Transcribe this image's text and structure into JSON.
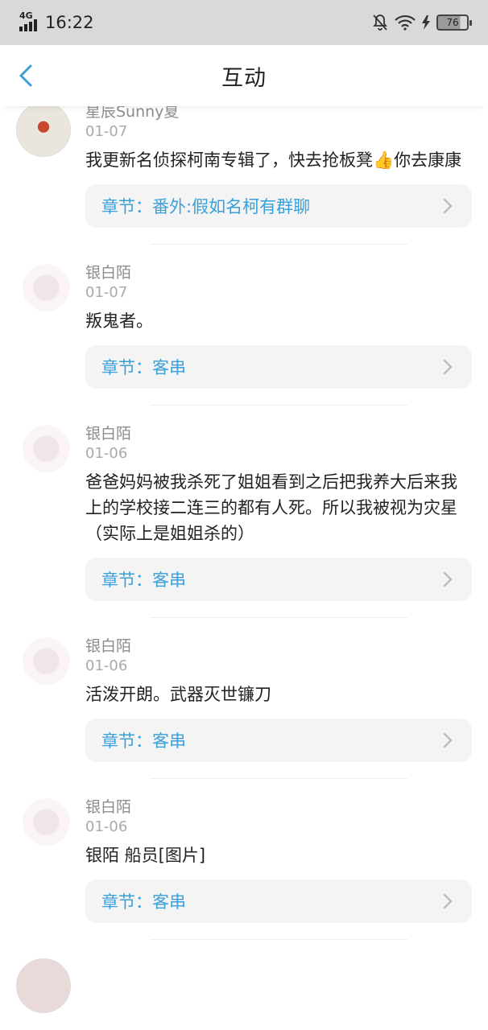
{
  "status": {
    "time": "16:22",
    "network": "4G",
    "battery": "76"
  },
  "header": {
    "title": "互动"
  },
  "items": [
    {
      "user": "星辰Sunny夏",
      "date": "01-07",
      "text": "我更新名侦探柯南专辑了，快去抢板凳👍你去康康",
      "chapter": "章节：番外:假如名柯有群聊"
    },
    {
      "user": "银白陌",
      "date": "01-07",
      "text": "叛鬼者。",
      "chapter": "章节：客串"
    },
    {
      "user": "银白陌",
      "date": "01-06",
      "text": "爸爸妈妈被我杀死了姐姐看到之后把我养大后来我上的学校接二连三的都有人死。所以我被视为灾星（实际上是姐姐杀的）",
      "chapter": "章节：客串"
    },
    {
      "user": "银白陌",
      "date": "01-06",
      "text": "活泼开朗。武器灭世镰刀",
      "chapter": "章节：客串"
    },
    {
      "user": "银白陌",
      "date": "01-06",
      "text": "银陌 船员[图片]",
      "chapter": "章节：客串"
    }
  ],
  "colors": {
    "accent": "#3aa0d8",
    "chapter_bg": "#f4f4f4",
    "status_bg": "#d9d9d9"
  }
}
